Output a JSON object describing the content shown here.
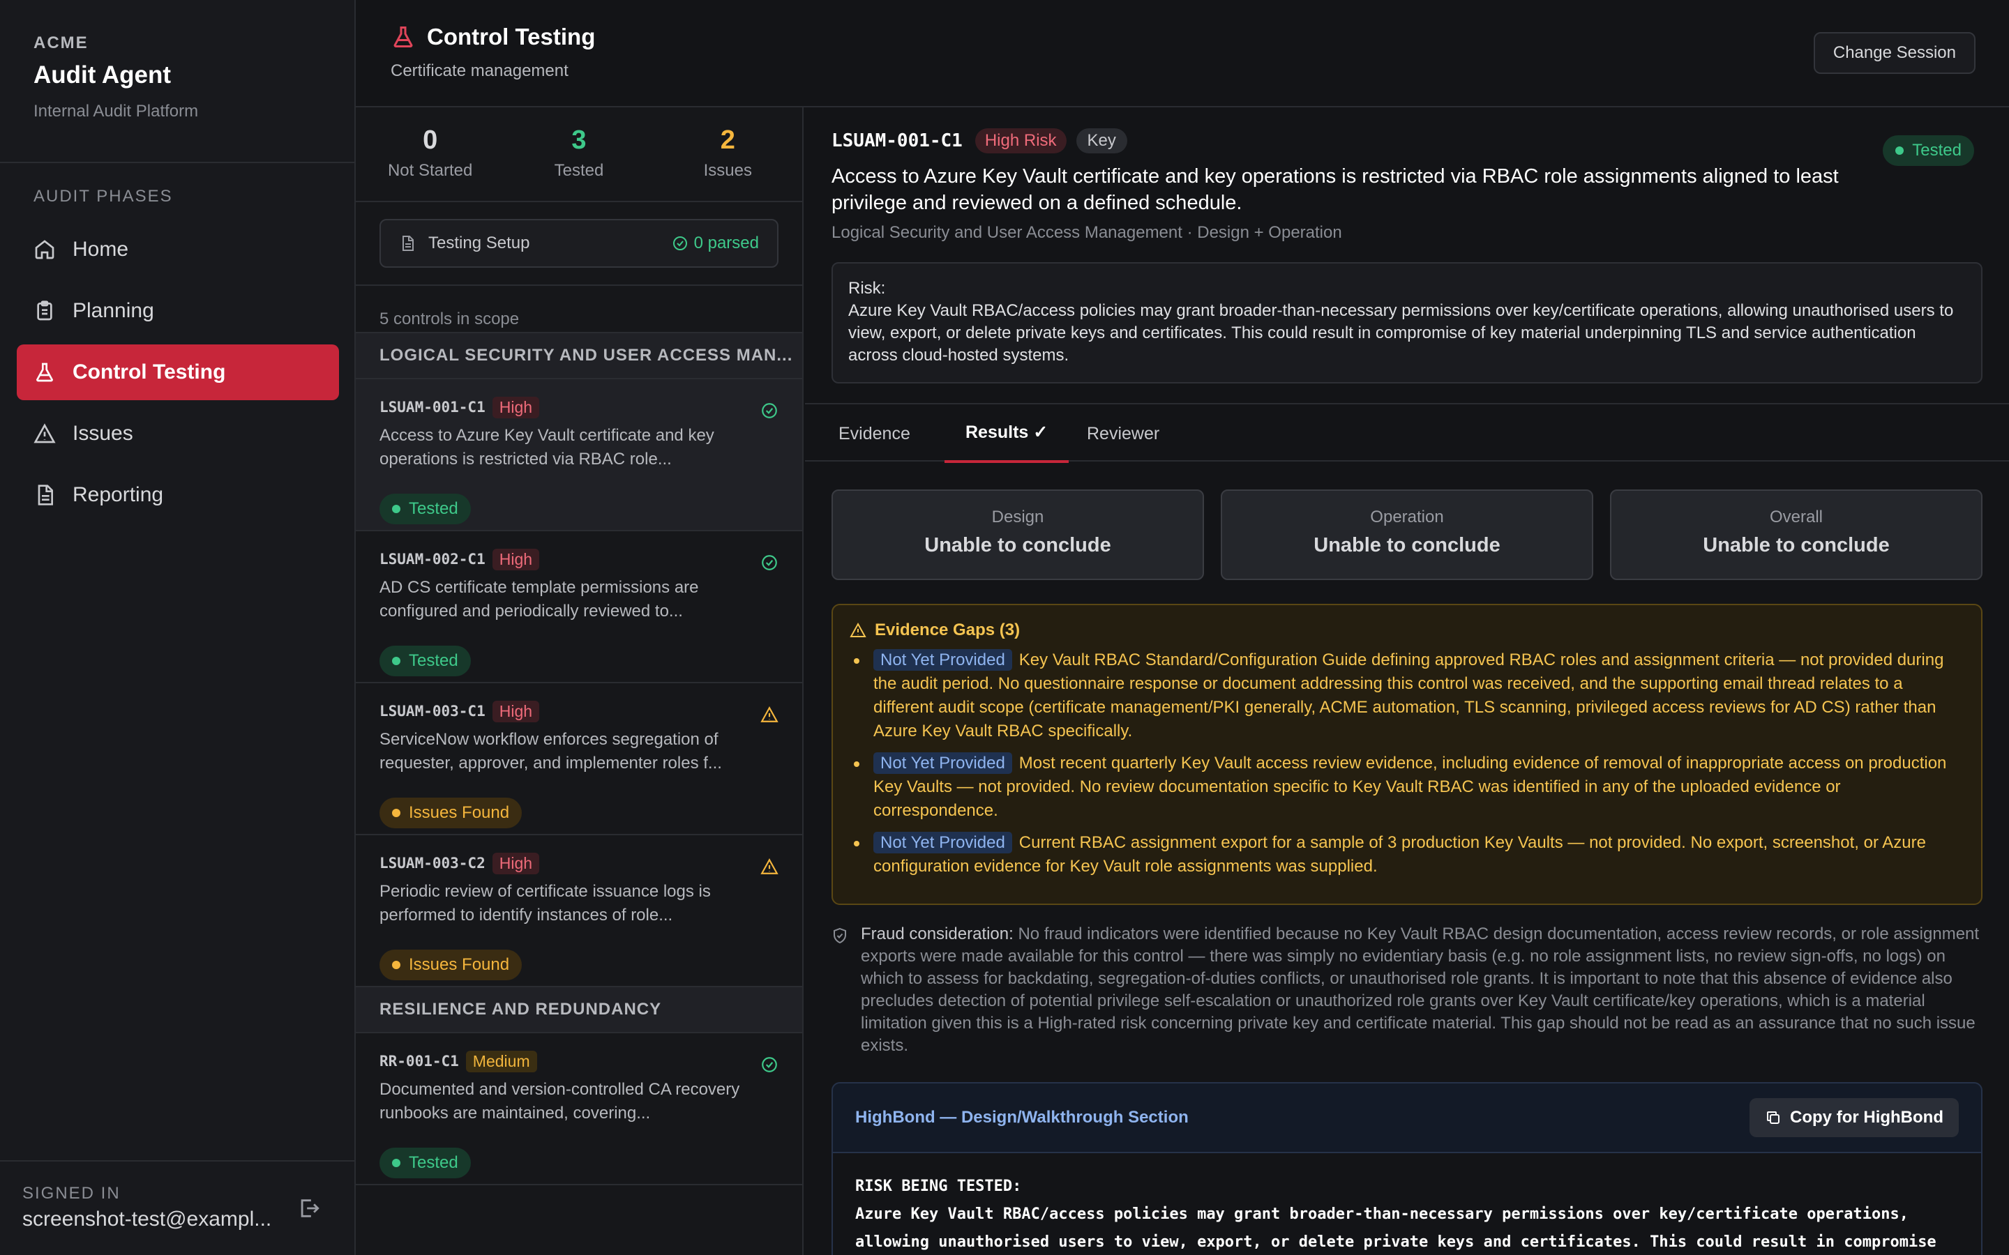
{
  "brand": {
    "org": "ACME",
    "title": "Audit Agent",
    "subtitle": "Internal Audit Platform"
  },
  "sidebar": {
    "section_label": "AUDIT PHASES",
    "items": [
      {
        "label": "Home",
        "icon": "home-icon"
      },
      {
        "label": "Planning",
        "icon": "clipboard-icon"
      },
      {
        "label": "Control Testing",
        "icon": "flask-icon",
        "active": true
      },
      {
        "label": "Issues",
        "icon": "warning-icon"
      },
      {
        "label": "Reporting",
        "icon": "document-icon"
      }
    ],
    "signed_in_label": "SIGNED IN",
    "user": "screenshot-test@exampl..."
  },
  "header": {
    "title": "Control Testing",
    "subtitle": "Certificate management",
    "change_session": "Change Session"
  },
  "stats": [
    {
      "value": "0",
      "label": "Not Started",
      "color": "#d8d9dc"
    },
    {
      "value": "3",
      "label": "Tested",
      "color": "#3ec98a"
    },
    {
      "value": "2",
      "label": "Issues",
      "color": "#f5b63d"
    }
  ],
  "setup": {
    "label": "Testing Setup",
    "parsed": "0 parsed"
  },
  "scope_text": "5 controls in scope",
  "groups": [
    {
      "name": "LOGICAL SECURITY AND USER ACCESS MAN...",
      "controls": [
        {
          "id": "LSUAM-001-C1",
          "rating": "High",
          "desc": "Access to Azure Key Vault certificate and key operations is restricted via RBAC role...",
          "status": "Tested",
          "icon": "check-circle-icon"
        },
        {
          "id": "LSUAM-002-C1",
          "rating": "High",
          "desc": "AD CS certificate template permissions are configured and periodically reviewed to...",
          "status": "Tested",
          "icon": "check-circle-icon"
        },
        {
          "id": "LSUAM-003-C1",
          "rating": "High",
          "desc": "ServiceNow workflow enforces segregation of requester, approver, and implementer roles f...",
          "status": "Issues Found",
          "icon": "warning-icon"
        },
        {
          "id": "LSUAM-003-C2",
          "rating": "High",
          "desc": "Periodic review of certificate issuance logs is performed to identify instances of role...",
          "status": "Issues Found",
          "icon": "warning-icon"
        }
      ]
    },
    {
      "name": "RESILIENCE AND REDUNDANCY",
      "controls": [
        {
          "id": "RR-001-C1",
          "rating": "Medium",
          "desc": "Documented and version-controlled CA recovery runbooks are maintained, covering...",
          "status": "Tested",
          "icon": "check-circle-icon"
        }
      ]
    }
  ],
  "detail": {
    "id": "LSUAM-001-C1",
    "risk_badge": "High Risk",
    "key_badge": "Key",
    "status": "Tested",
    "title": "Access to Azure Key Vault certificate and key operations is restricted via RBAC role assignments aligned to least privilege and reviewed on a defined schedule.",
    "meta": "Logical Security and User Access Management · Design + Operation",
    "risk_label": "Risk:",
    "risk_text": "Azure Key Vault RBAC/access policies may grant broader-than-necessary permissions over key/certificate operations, allowing unauthorised users to view, export, or delete private keys and certificates. This could result in compromise of key material underpinning TLS and service authentication across cloud-hosted systems.",
    "tabs": [
      "Evidence",
      "Results ✓",
      "Reviewer"
    ],
    "results": [
      {
        "label": "Design",
        "value": "Unable to conclude"
      },
      {
        "label": "Operation",
        "value": "Unable to conclude"
      },
      {
        "label": "Overall",
        "value": "Unable to conclude"
      }
    ],
    "gaps_title": "Evidence Gaps (3)",
    "gaps": [
      {
        "tag": "Not Yet Provided",
        "text": "Key Vault RBAC Standard/Configuration Guide defining approved RBAC roles and assignment criteria — not provided during the audit period. No questionnaire response or document addressing this control was received, and the supporting email thread relates to a different audit scope (certificate management/PKI generally, ACME automation, TLS scanning, privileged access reviews for AD CS) rather than Azure Key Vault RBAC specifically."
      },
      {
        "tag": "Not Yet Provided",
        "text": "Most recent quarterly Key Vault access review evidence, including evidence of removal of inappropriate access on production Key Vaults — not provided. No review documentation specific to Key Vault RBAC was identified in any of the uploaded evidence or correspondence."
      },
      {
        "tag": "Not Yet Provided",
        "text": "Current RBAC assignment export for a sample of 3 production Key Vaults — not provided. No export, screenshot, or Azure configuration evidence for Key Vault role assignments was supplied."
      }
    ],
    "fraud_label": "Fraud consideration:",
    "fraud_text": " No fraud indicators were identified because no Key Vault RBAC design documentation, access review records, or role assignment exports were made available for this control — there was simply no evidentiary basis (e.g. no role assignment lists, no review sign-offs, no logs) on which to assess for backdating, segregation-of-duties conflicts, or unauthorised role grants. It is important to note that this absence of evidence also precludes detection of potential privilege self-escalation or unauthorized role grants over Key Vault certificate/key operations, which is a material limitation given this is a High-rated risk concerning private key and certificate material. This gap should not be read as an assurance that no such issue exists.",
    "highbond": {
      "title": "HighBond — Design/Walkthrough Section",
      "copy": "Copy for HighBond",
      "lines": [
        "RISK BEING TESTED:",
        "Azure Key Vault RBAC/access policies may grant broader-than-necessary permissions over key/certificate operations,",
        "allowing unauthorised users to view, export, or delete private keys and certificates. This could result in compromise"
      ]
    }
  }
}
